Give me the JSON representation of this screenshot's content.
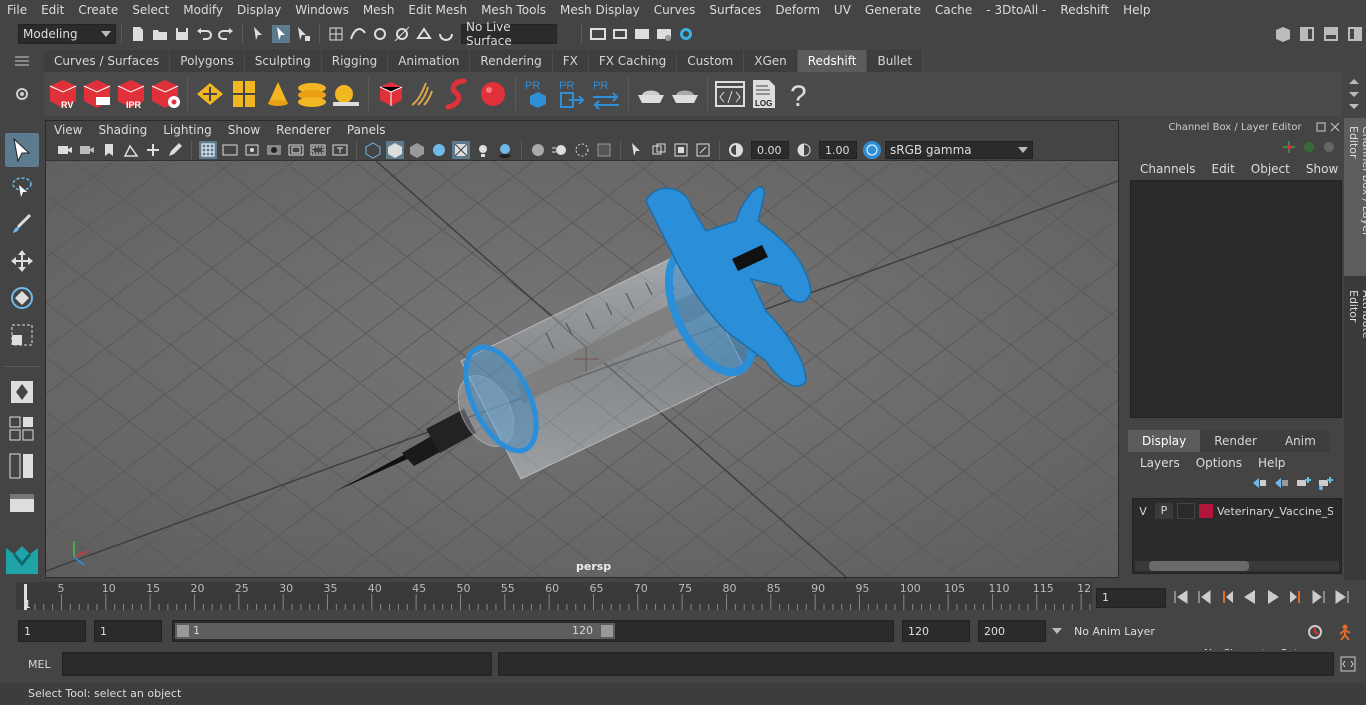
{
  "menubar": [
    "File",
    "Edit",
    "Create",
    "Select",
    "Modify",
    "Display",
    "Windows",
    "Mesh",
    "Edit Mesh",
    "Mesh Tools",
    "Mesh Display",
    "Curves",
    "Surfaces",
    "Deform",
    "UV",
    "Generate",
    "Cache",
    "- 3DtoAll -",
    "Redshift",
    "Help"
  ],
  "status": {
    "mode": "Modeling",
    "live_surface": "No Live Surface"
  },
  "shelf_tabs": [
    "Curves / Surfaces",
    "Polygons",
    "Sculpting",
    "Rigging",
    "Animation",
    "Rendering",
    "FX",
    "FX Caching",
    "Custom",
    "XGen",
    "Redshift",
    "Bullet"
  ],
  "shelf_active": "Redshift",
  "shelf_icons": {
    "rv": "RV",
    "ipr": "IPR",
    "pr": "PR",
    "log": "LOG",
    "help": "?"
  },
  "viewport": {
    "menu": [
      "View",
      "Shading",
      "Lighting",
      "Show",
      "Renderer",
      "Panels"
    ],
    "exposure": "0.00",
    "gamma": "1.00",
    "colorspace": "sRGB gamma",
    "camera": "persp"
  },
  "channel_box": {
    "title": "Channel Box / Layer Editor",
    "menu": [
      "Channels",
      "Edit",
      "Object",
      "Show"
    ]
  },
  "layer_editor": {
    "tabs": [
      "Display",
      "Render",
      "Anim"
    ],
    "menu": [
      "Layers",
      "Options",
      "Help"
    ],
    "layer": {
      "v": "V",
      "p": "P",
      "name": "Veterinary_Vaccine_Syr"
    },
    "layer_color": "#b0163a"
  },
  "side_tabs": [
    "Channel Box / Layer Editor",
    "Attribute Editor"
  ],
  "timeline": {
    "ticks": [
      "5",
      "10",
      "15",
      "20",
      "25",
      "30",
      "35",
      "40",
      "45",
      "50",
      "55",
      "60",
      "65",
      "70",
      "75",
      "80",
      "85",
      "90",
      "95",
      "100",
      "105",
      "110",
      "115",
      "12"
    ],
    "first": "1",
    "current_frame": "1"
  },
  "range": {
    "start": "1",
    "start2": "1",
    "slider_start": "1",
    "slider_end": "120",
    "end": "120",
    "end2": "200",
    "anim_layer": "No Anim Layer",
    "char_set": "No Character Set"
  },
  "mel_label": "MEL",
  "help_text": "Select Tool: select an object",
  "colors": {
    "accent_blue": "#2f8fd6",
    "syringe_blue": "#2a8fd8",
    "redshift_red": "#e0303a",
    "yellow": "#f3b623"
  }
}
